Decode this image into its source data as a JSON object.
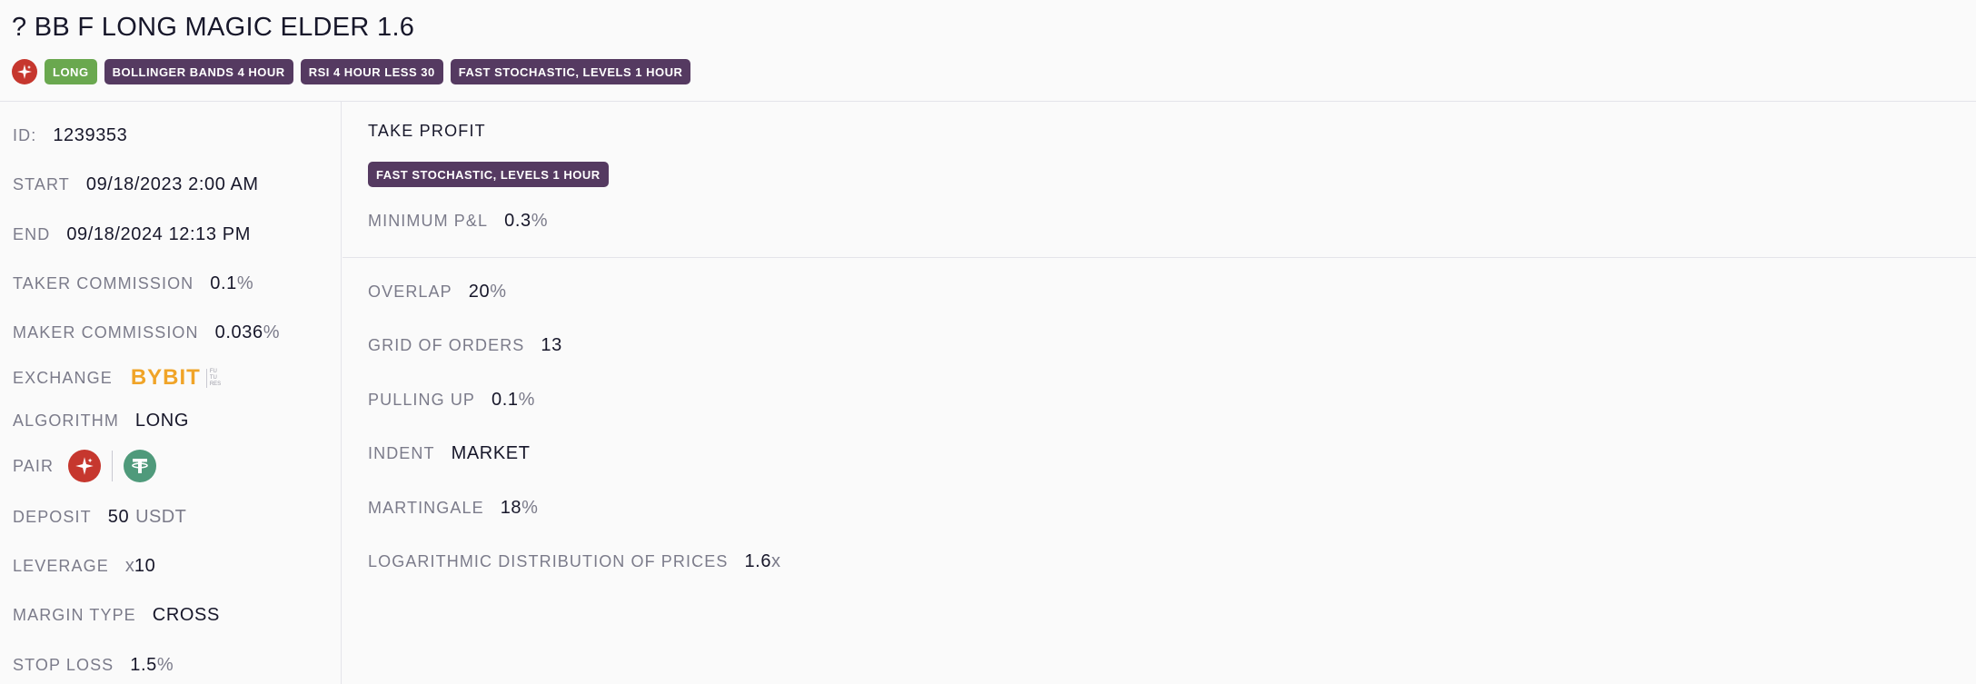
{
  "header": {
    "title": "? BB F LONG MAGIC ELDER 1.6",
    "tags": [
      "LONG",
      "BOLLINGER BANDS 4 HOUR",
      "RSI 4 HOUR LESS 30",
      "FAST STOCHASTIC, LEVELS 1 HOUR"
    ]
  },
  "details": {
    "id": {
      "label": "ID:",
      "value": "1239353"
    },
    "start": {
      "label": "START",
      "value": "09/18/2023 2:00 AM"
    },
    "end": {
      "label": "END",
      "value": "09/18/2024 12:13 PM"
    },
    "taker": {
      "label": "TAKER COMMISSION",
      "value": "0.1",
      "unit": "%"
    },
    "maker": {
      "label": "MAKER COMMISSION",
      "value": "0.036",
      "unit": "%"
    },
    "exchange": {
      "label": "EXCHANGE",
      "logo_text": "BYBIT",
      "logo_sub": [
        "FU",
        "TU",
        "RES"
      ]
    },
    "algorithm": {
      "label": "ALGORITHM",
      "value": "LONG"
    },
    "pair": {
      "label": "PAIR",
      "base_icon": "sparkle-coin-icon",
      "quote_icon": "tether-icon"
    },
    "deposit": {
      "label": "DEPOSIT",
      "value": "50",
      "unit": "USDT"
    },
    "leverage": {
      "label": "LEVERAGE",
      "prefix": "x",
      "value": "10"
    },
    "margin": {
      "label": "MARGIN TYPE",
      "value": "CROSS"
    },
    "stop_loss": {
      "label": "STOP LOSS",
      "value": "1.5",
      "unit": "%"
    }
  },
  "take_profit": {
    "title": "TAKE PROFIT",
    "tag": "FAST STOCHASTIC, LEVELS 1 HOUR",
    "min_pnl": {
      "label": "MINIMUM P&L",
      "value": "0.3",
      "unit": "%"
    }
  },
  "grid": {
    "overlap": {
      "label": "OVERLAP",
      "value": "20",
      "unit": "%"
    },
    "orders": {
      "label": "GRID OF ORDERS",
      "value": "13"
    },
    "pulling": {
      "label": "PULLING UP",
      "value": "0.1",
      "unit": "%"
    },
    "indent": {
      "label": "INDENT",
      "value": "MARKET"
    },
    "martingale": {
      "label": "MARTINGALE",
      "value": "18",
      "unit": "%"
    },
    "log_dist": {
      "label": "LOGARITHMIC DISTRIBUTION OF PRICES",
      "value": "1.6",
      "unit": "x"
    }
  },
  "colors": {
    "long_tag": "#6aa84f",
    "indicator_tag": "#553a61",
    "coin_red": "#c6372e",
    "coin_green": "#4f9a7b",
    "bybit": "#f0a428"
  }
}
